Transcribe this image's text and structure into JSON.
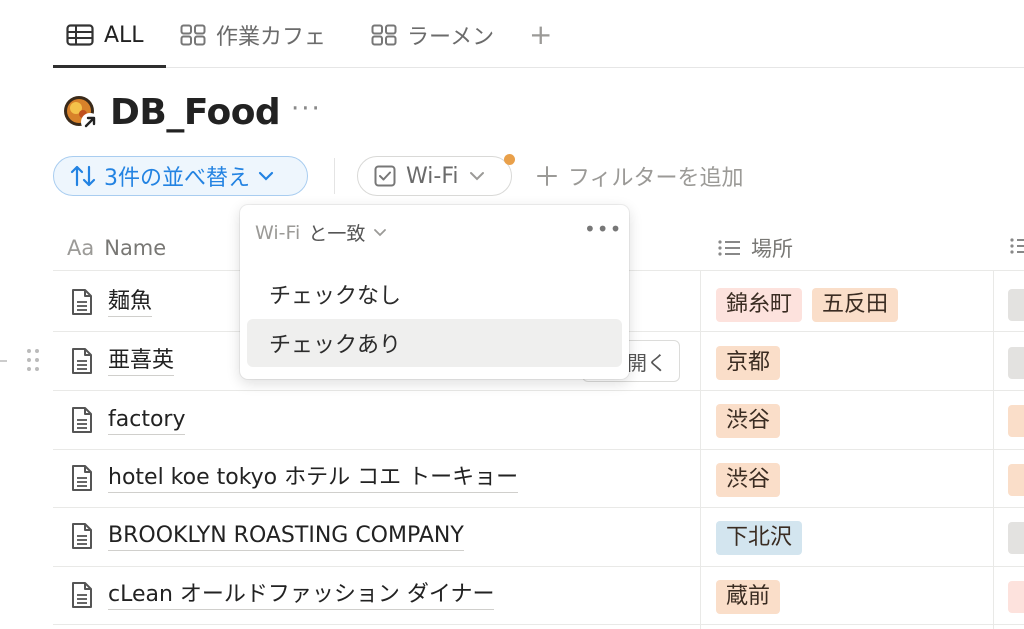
{
  "tabs": [
    {
      "label": "ALL",
      "icon": "table-icon",
      "active": true
    },
    {
      "label": "作業カフェ",
      "icon": "gallery-icon",
      "active": false
    },
    {
      "label": "ラーメン",
      "icon": "gallery-icon",
      "active": false
    }
  ],
  "add_tab_label": "+",
  "database": {
    "title": "DB_Food",
    "icon": "food-emoji-icon",
    "more_label": "···"
  },
  "toolbar": {
    "sort_label": "3件の並べ替え",
    "filter_label": "Wi-Fi",
    "add_filter_label": "フィルターを追加"
  },
  "filter_popup": {
    "field": "Wi-Fi",
    "match": "と一致",
    "more_label": "•••",
    "options": [
      {
        "label": "チェックなし",
        "highlighted": false
      },
      {
        "label": "チェックあり",
        "highlighted": true
      }
    ]
  },
  "columns": [
    {
      "label": "Name",
      "prefix": "Aa"
    },
    {
      "label": "場所",
      "icon": "list-icon"
    }
  ],
  "open_label": "開く",
  "rows": [
    {
      "name": "麺魚",
      "tags": [
        {
          "label": "錦糸町",
          "color": "#fde2dd"
        },
        {
          "label": "五反田",
          "color": "#fadec9"
        }
      ]
    },
    {
      "name": "亜喜英",
      "tags": [
        {
          "label": "京都",
          "color": "#fadec9"
        }
      ]
    },
    {
      "name": "factory",
      "tags": [
        {
          "label": "渋谷",
          "color": "#fadec9"
        }
      ]
    },
    {
      "name": "hotel koe tokyo ホテル コエ トーキョー",
      "tags": [
        {
          "label": "渋谷",
          "color": "#fadec9"
        }
      ]
    },
    {
      "name": "BROOKLYN ROASTING COMPANY",
      "tags": [
        {
          "label": "下北沢",
          "color": "#d3e5ef"
        }
      ]
    },
    {
      "name": "cLean オールドファッション ダイナー",
      "tags": [
        {
          "label": "蔵前",
          "color": "#fadec9"
        }
      ]
    }
  ],
  "colors": {
    "accent": "#2383e2",
    "filter_dot": "#e9a04a"
  }
}
